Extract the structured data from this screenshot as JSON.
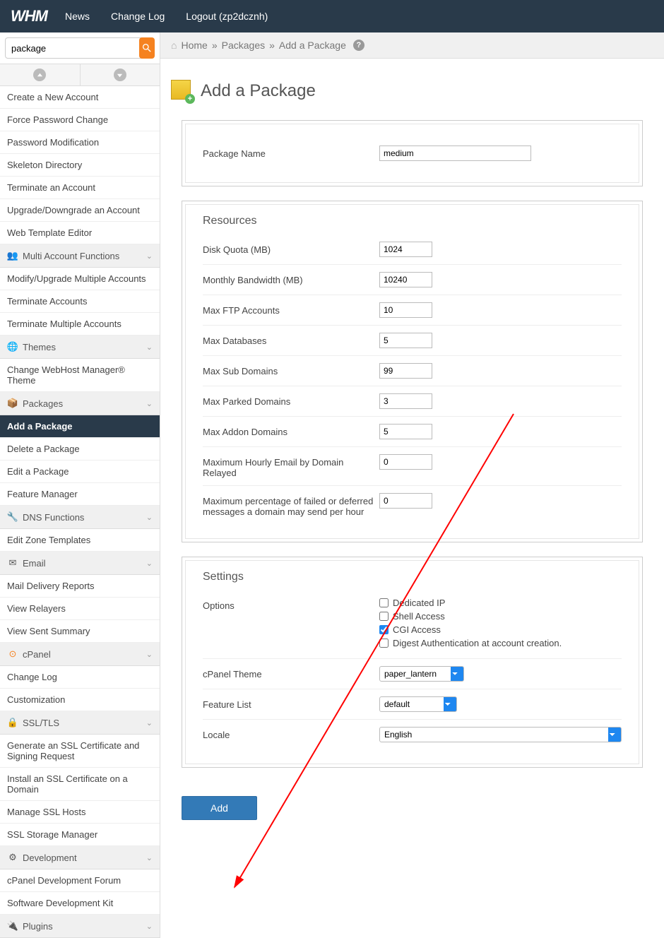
{
  "topbar": {
    "logo": "WHM",
    "nav": {
      "news": "News",
      "changelog": "Change Log",
      "logout": "Logout (zp2dcznh)"
    }
  },
  "search": {
    "value": "package"
  },
  "sidebar": {
    "items1": [
      "Create a New Account",
      "Force Password Change",
      "Password Modification",
      "Skeleton Directory",
      "Terminate an Account",
      "Upgrade/Downgrade an Account",
      "Web Template Editor"
    ],
    "sec_multi": "Multi Account Functions",
    "items2": [
      "Modify/Upgrade Multiple Accounts",
      "Terminate Accounts",
      "Terminate Multiple Accounts"
    ],
    "sec_themes": "Themes",
    "items3": [
      "Change WebHost Manager® Theme"
    ],
    "sec_packages": "Packages",
    "items4": [
      "Add a Package",
      "Delete a Package",
      "Edit a Package",
      "Feature Manager"
    ],
    "sec_dns": "DNS Functions",
    "items5": [
      "Edit Zone Templates"
    ],
    "sec_email": "Email",
    "items6": [
      "Mail Delivery Reports",
      "View Relayers",
      "View Sent Summary"
    ],
    "sec_cpanel": "cPanel",
    "items7": [
      "Change Log",
      "Customization"
    ],
    "sec_ssl": "SSL/TLS",
    "items8": [
      "Generate an SSL Certificate and Signing Request",
      "Install an SSL Certificate on a Domain",
      "Manage SSL Hosts",
      "SSL Storage Manager"
    ],
    "sec_dev": "Development",
    "items9": [
      "cPanel Development Forum",
      "Software Development Kit"
    ],
    "sec_plugins": "Plugins"
  },
  "breadcrumb": {
    "home": "Home",
    "packages": "Packages",
    "current": "Add a Package"
  },
  "page": {
    "title": "Add a Package"
  },
  "form": {
    "package_name_label": "Package Name",
    "package_name_value": "medium",
    "resources_title": "Resources",
    "rows": {
      "disk_quota": {
        "label": "Disk Quota (MB)",
        "value": "1024"
      },
      "bandwidth": {
        "label": "Monthly Bandwidth (MB)",
        "value": "10240"
      },
      "ftp": {
        "label": "Max FTP Accounts",
        "value": "10"
      },
      "db": {
        "label": "Max Databases",
        "value": "5"
      },
      "sub": {
        "label": "Max Sub Domains",
        "value": "99"
      },
      "parked": {
        "label": "Max Parked Domains",
        "value": "3"
      },
      "addon": {
        "label": "Max Addon Domains",
        "value": "5"
      },
      "hourly": {
        "label": "Maximum Hourly Email by Domain Relayed",
        "value": "0"
      },
      "failed": {
        "label": "Maximum percentage of failed or deferred messages a domain may send per hour",
        "value": "0"
      }
    },
    "settings_title": "Settings",
    "options_label": "Options",
    "options": {
      "dedicated_ip": "Dedicated IP",
      "shell": "Shell Access",
      "cgi": "CGI Access",
      "digest": "Digest Authentication at account creation."
    },
    "theme_label": "cPanel Theme",
    "theme_value": "paper_lantern",
    "feature_label": "Feature List",
    "feature_value": "default",
    "locale_label": "Locale",
    "locale_value": "English",
    "add_btn": "Add"
  }
}
